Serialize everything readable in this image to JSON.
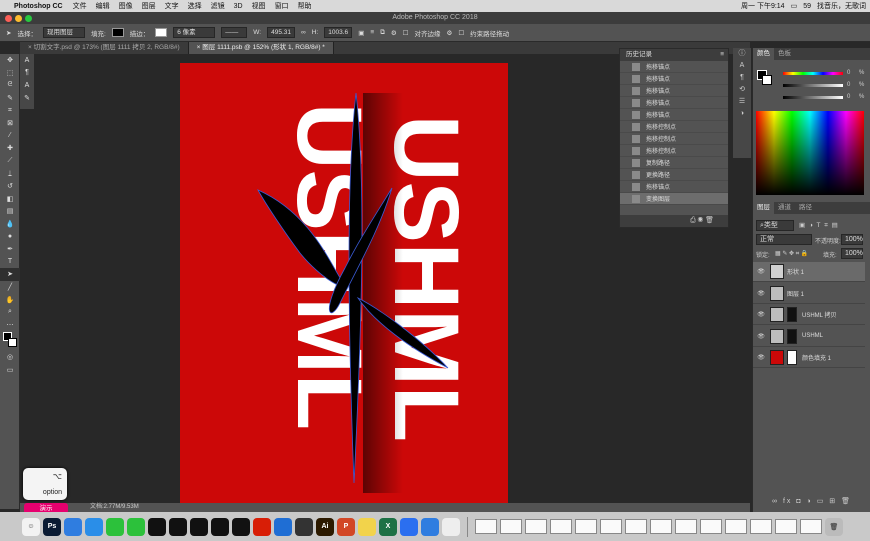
{
  "menubar": {
    "app_name": "Photoshop CC",
    "menus": [
      "文件",
      "编辑",
      "图像",
      "图层",
      "文字",
      "选择",
      "滤镜",
      "3D",
      "视图",
      "窗口",
      "帮助"
    ],
    "clock": "周一 下午9:14",
    "battery": "59",
    "right_text": "找音乐，无歌词"
  },
  "titlebar": {
    "title": "Adobe Photoshop CC 2018"
  },
  "options": {
    "select_label": "选择：",
    "select_value": "现用图层",
    "fill_label": "填充:",
    "stroke_label": "描边：",
    "stroke_width": "6 像素",
    "w_label": "W:",
    "w_value": "495.31",
    "h_label": "H:",
    "h_value": "1003.6",
    "align_edges": "对齐边缘",
    "constrain_path": "约束路径拖动"
  },
  "tabs": [
    {
      "label": "切割文字.psd @ 173% (图层 1111 拷贝 2, RGB/8#)",
      "active": false
    },
    {
      "label": "图层 1111.psb @ 152% (形状 1, RGB/8#) *",
      "active": true
    }
  ],
  "canvas": {
    "text": "USHML"
  },
  "status": {
    "doc_size": "文档:2.77M/9.53M"
  },
  "history": {
    "title": "历史记录",
    "items": [
      "拖移锚点",
      "拖移锚点",
      "拖移锚点",
      "拖移锚点",
      "拖移锚点",
      "拖移控制点",
      "拖移控制点",
      "拖移控制点",
      "复制路径",
      "更换路径",
      "拖移锚点",
      "变换图层"
    ],
    "selected_index": 11
  },
  "color_panel": {
    "tabs": [
      "颜色",
      "色板"
    ],
    "sliders": [
      "0",
      "0",
      "0"
    ],
    "unit": "%"
  },
  "layers_panel": {
    "tabs": [
      "图层",
      "通道",
      "路径"
    ],
    "kind_label": "类型",
    "blend_mode": "正常",
    "opacity_label": "不透明度:",
    "opacity_value": "100%",
    "lock_label": "锁定:",
    "fill_label": "填充:",
    "fill_value": "100%",
    "layers": [
      {
        "name": "形状 1",
        "selected": true,
        "thumb": "#d0d0d0",
        "mask": ""
      },
      {
        "name": "图层 1",
        "selected": false,
        "thumb": "#bdbdbd",
        "mask": ""
      },
      {
        "name": "USHML 拷贝",
        "selected": false,
        "thumb": "#bdbdbd",
        "mask": "#111111"
      },
      {
        "name": "USHML",
        "selected": false,
        "thumb": "#bdbdbd",
        "mask": "#111111"
      },
      {
        "name": "颜色填充 1",
        "selected": false,
        "thumb": "#cc0808",
        "mask": "#ffffff"
      }
    ]
  },
  "keycast": {
    "symbol": "⌥",
    "key": "option"
  },
  "demo_label": "演示",
  "dock": {
    "apps": [
      {
        "name": "Ps",
        "color": "#0a1b33",
        "text": "Ps",
        "badge": ""
      },
      {
        "name": "chrome",
        "color": "#2f7de0",
        "text": "",
        "badge": ""
      },
      {
        "name": "safari",
        "color": "#2a8ee8",
        "text": "",
        "badge": ""
      },
      {
        "name": "wechat",
        "color": "#2cc13b",
        "text": "",
        "badge": ""
      },
      {
        "name": "wechat2",
        "color": "#2cc13b",
        "text": "",
        "badge": ""
      },
      {
        "name": "qq",
        "color": "#111",
        "text": "",
        "badge": ""
      },
      {
        "name": "qq2",
        "color": "#111",
        "text": "",
        "badge": ""
      },
      {
        "name": "qq3",
        "color": "#111",
        "text": "",
        "badge": ""
      },
      {
        "name": "qq4",
        "color": "#111",
        "text": "",
        "badge": ""
      },
      {
        "name": "qq5",
        "color": "#111",
        "text": "",
        "badge": ""
      },
      {
        "name": "netease",
        "color": "#d81e06",
        "text": "",
        "badge": ""
      },
      {
        "name": "browser",
        "color": "#1f6ed4",
        "text": "",
        "badge": ""
      },
      {
        "name": "app",
        "color": "#333",
        "text": "",
        "badge": ""
      },
      {
        "name": "Ai",
        "color": "#2c1a00",
        "text": "Ai",
        "badge": ""
      },
      {
        "name": "ppt",
        "color": "#d24726",
        "text": "P",
        "badge": ""
      },
      {
        "name": "notes",
        "color": "#f2d34b",
        "text": "",
        "badge": ""
      },
      {
        "name": "excel",
        "color": "#1d7145",
        "text": "X",
        "badge": ""
      },
      {
        "name": "baidu",
        "color": "#2b6ff0",
        "text": "",
        "badge": ""
      },
      {
        "name": "chrome2",
        "color": "#2f7de0",
        "text": "",
        "badge": ""
      },
      {
        "name": "photos",
        "color": "#eee",
        "text": "",
        "badge": ""
      }
    ]
  }
}
